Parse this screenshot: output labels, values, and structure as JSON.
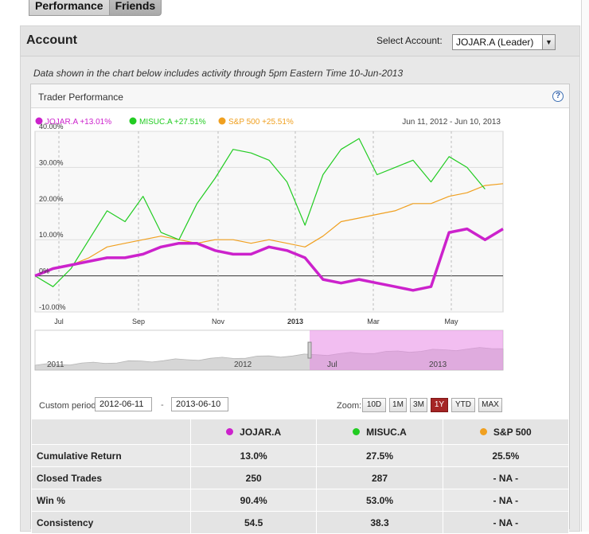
{
  "tabs": [
    {
      "label": "Performance"
    },
    {
      "label": "Friends"
    }
  ],
  "account": {
    "title": "Account",
    "select_label": "Select Account:",
    "select_value": "JOJAR.A (Leader)"
  },
  "data_note": "Data shown in the chart below includes activity through 5pm Eastern Time 10-Jun-2013",
  "panel_title": "Trader Performance",
  "help_glyph": "?",
  "legend": [
    {
      "label": "JOJAR.A +13.01%",
      "color": "#cc22cc"
    },
    {
      "label": "MISUC.A +27.51%",
      "color": "#22cc22"
    },
    {
      "label": "S&P 500 +25.51%",
      "color": "#f0a020"
    }
  ],
  "date_range": "Jun 11, 2012 - Jun 10, 2013",
  "chart_data": {
    "type": "line",
    "y_ticks": [
      "40.00%",
      "30.00%",
      "20.00%",
      "10.00%",
      "0%",
      "-10.00%"
    ],
    "x_ticks": [
      "Jul",
      "Sep",
      "Nov",
      "2013",
      "Mar",
      "May"
    ],
    "ylim": [
      -10,
      40
    ],
    "grid": true,
    "series": [
      {
        "name": "JOJAR.A",
        "color": "#cc22cc",
        "x": [
          0,
          2,
          4,
          6,
          8,
          10,
          12,
          14,
          16,
          18,
          20,
          22,
          24,
          26,
          28,
          30,
          32,
          34,
          36,
          38,
          40,
          42,
          44,
          46,
          48,
          50,
          52
        ],
        "values": [
          0,
          2,
          3,
          4,
          5,
          5,
          6,
          8,
          9,
          9,
          7,
          6,
          6,
          8,
          7,
          5,
          -1,
          -2,
          -1,
          -2,
          -3,
          -4,
          -3,
          12,
          13,
          10,
          13
        ]
      },
      {
        "name": "MISUC.A",
        "color": "#22cc22",
        "x": [
          0,
          2,
          4,
          6,
          8,
          10,
          12,
          14,
          16,
          18,
          20,
          22,
          24,
          26,
          28,
          30,
          32,
          34,
          36,
          38,
          40,
          42,
          44,
          46,
          48,
          50
        ],
        "values": [
          0,
          -3,
          2,
          10,
          18,
          15,
          22,
          12,
          10,
          20,
          27,
          35,
          34,
          32,
          26,
          14,
          28,
          35,
          38,
          28,
          30,
          32,
          26,
          33,
          30,
          24
        ]
      },
      {
        "name": "S&P 500",
        "color": "#f0a020",
        "x": [
          0,
          2,
          4,
          6,
          8,
          10,
          12,
          14,
          16,
          18,
          20,
          22,
          24,
          26,
          28,
          30,
          32,
          34,
          36,
          38,
          40,
          42,
          44,
          46,
          48,
          50,
          52
        ],
        "values": [
          0,
          2,
          3,
          5,
          8,
          9,
          10,
          11,
          10,
          9,
          10,
          10,
          9,
          10,
          9,
          8,
          11,
          15,
          16,
          17,
          18,
          20,
          20,
          22,
          23,
          25,
          25.5
        ]
      }
    ],
    "navigator": {
      "labels": [
        "2011",
        "2012",
        "Jul",
        "2013"
      ]
    }
  },
  "custom_period": {
    "label": "Custom period:",
    "start": "2012-06-11",
    "end": "2013-06-10",
    "separator": "-"
  },
  "zoom": {
    "label": "Zoom:",
    "buttons": [
      "10D",
      "1M",
      "3M",
      "1Y",
      "YTD",
      "MAX"
    ],
    "active": "1Y"
  },
  "table": {
    "columns": [
      {
        "name": "JOJAR.A",
        "color": "#cc22cc"
      },
      {
        "name": "MISUC.A",
        "color": "#22cc22"
      },
      {
        "name": "S&P 500",
        "color": "#f0a020"
      }
    ],
    "rows": [
      {
        "label": "Cumulative Return",
        "values": [
          "13.0%",
          "27.5%",
          "25.5%"
        ]
      },
      {
        "label": "Closed Trades",
        "values": [
          "250",
          "287",
          "- NA -"
        ]
      },
      {
        "label": "Win %",
        "values": [
          "90.4%",
          "53.0%",
          "- NA -"
        ]
      },
      {
        "label": "Consistency",
        "values": [
          "54.5",
          "38.3",
          "- NA -"
        ]
      }
    ]
  }
}
